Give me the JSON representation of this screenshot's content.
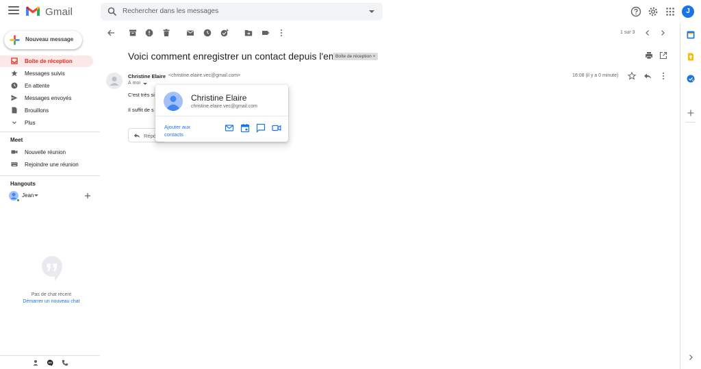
{
  "app": {
    "name": "Gmail"
  },
  "colors": {
    "accent": "#1a73e8",
    "red": "#d93025",
    "active_bg": "#fce8e6",
    "green": "#0f9d58",
    "yellow": "#fbbc04"
  },
  "header": {
    "search_placeholder": "Rechercher dans les messages",
    "avatar_initial": "J",
    "icons": [
      "help-icon",
      "settings-icon",
      "apps-grid-icon"
    ]
  },
  "sidebar": {
    "compose_label": "Nouveau message",
    "items": [
      {
        "label": "Boîte de réception",
        "icon": "inbox-icon",
        "active": true
      },
      {
        "label": "Messages suivis",
        "icon": "star-icon"
      },
      {
        "label": "En attente",
        "icon": "clock-icon"
      },
      {
        "label": "Messages envoyés",
        "icon": "send-icon"
      },
      {
        "label": "Brouillons",
        "icon": "draft-icon"
      },
      {
        "label": "Plus",
        "icon": "chevron-down-icon"
      }
    ],
    "meet": {
      "title": "Meet",
      "items": [
        {
          "label": "Nouvelle réunion",
          "icon": "videocam-icon"
        },
        {
          "label": "Rejoindre une réunion",
          "icon": "keyboard-icon"
        }
      ]
    },
    "hangouts": {
      "title": "Hangouts",
      "user": "Jean",
      "no_chat": "Pas de chat récent",
      "new_chat": "Démarrer un nouveau chat"
    }
  },
  "toolbar": {
    "pager": "1 sur 3"
  },
  "email": {
    "subject": "Voici comment enregistrer un contact depuis l'email",
    "label_chip": "Boîte de réception ×",
    "sender_name": "Christine Elaire",
    "sender_email": "<christine.elaire.vec@gmail.com>",
    "to": "À moi",
    "time": "16:08 (il y a 0 minute)",
    "body_line1": "C'est très si",
    "body_line2": "Il suffit de s",
    "reply_label": "Répo"
  },
  "contact_card": {
    "name": "Christine Elaire",
    "email": "christine.elaire.vec@gmail.com",
    "add_contact": "Ajouter aux contacts"
  }
}
